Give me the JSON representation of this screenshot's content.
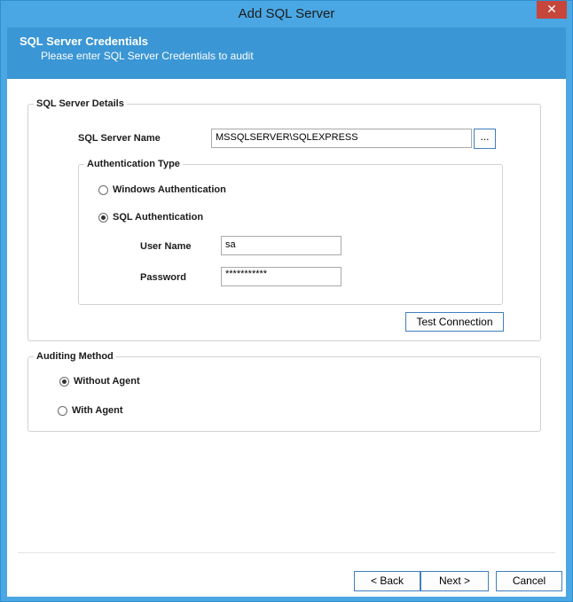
{
  "window": {
    "title": "Add SQL Server",
    "close_glyph": "✕"
  },
  "banner": {
    "title": "SQL Server Credentials",
    "subtitle": "Please enter SQL Server Credentials to audit"
  },
  "server_details": {
    "group_label": "SQL Server Details",
    "server_name_label": "SQL Server Name",
    "server_name_value": "MSSQLSERVER\\SQLEXPRESS",
    "browse_label": "...",
    "auth_group_label": "Authentication Type",
    "windows_auth_label": "Windows Authentication",
    "sql_auth_label": "SQL Authentication",
    "username_label": "User Name",
    "username_value": "sa",
    "password_label": "Password",
    "password_value": "***********",
    "test_connection_label": "Test Connection"
  },
  "auditing": {
    "group_label": "Auditing Method",
    "without_agent_label": "Without Agent",
    "with_agent_label": "With Agent"
  },
  "footer": {
    "back_label": "< Back",
    "next_label": "Next >",
    "cancel_label": "Cancel"
  }
}
